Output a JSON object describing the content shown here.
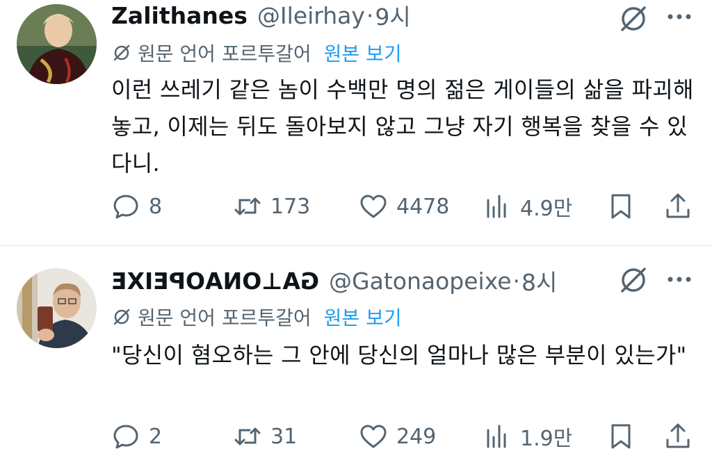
{
  "tweets": [
    {
      "author": {
        "display_name": "Zalithanes",
        "handle": "@Ileirhay",
        "time": "9시"
      },
      "translation": {
        "label": "원문 언어 포르투갈어",
        "view_original": "원본 보기"
      },
      "text": "이런 쓰레기 같은 놈이 수백만 명의 젊은 게이들의 삶을 파괴해놓고, 이제는 뒤도 돌아보지 않고 그냥 자기 행복을 찾을 수 있다니.",
      "stats": {
        "replies": "8",
        "retweets": "173",
        "likes": "4478",
        "views": "4.9만"
      }
    },
    {
      "author": {
        "display_name": "GA⊥ONAOPEIXE",
        "handle": "@Gatonaopeixe",
        "time": "8시"
      },
      "translation": {
        "label": "원문 언어 포르투갈어",
        "view_original": "원본 보기"
      },
      "text": "\"당신이 혐오하는 그 안에 당신의 얼마나 많은 부분이 있는가\"",
      "stats": {
        "replies": "2",
        "retweets": "31",
        "likes": "249",
        "views": "1.9만"
      }
    }
  ],
  "colors": {
    "primary_text": "#0f1419",
    "secondary_text": "#536471",
    "link": "#1d9bf0",
    "divider": "#eff3f4"
  },
  "icons": [
    "grok-icon",
    "more-icon",
    "translate-icon",
    "reply-icon",
    "retweet-icon",
    "like-icon",
    "views-icon",
    "bookmark-icon",
    "share-icon"
  ]
}
